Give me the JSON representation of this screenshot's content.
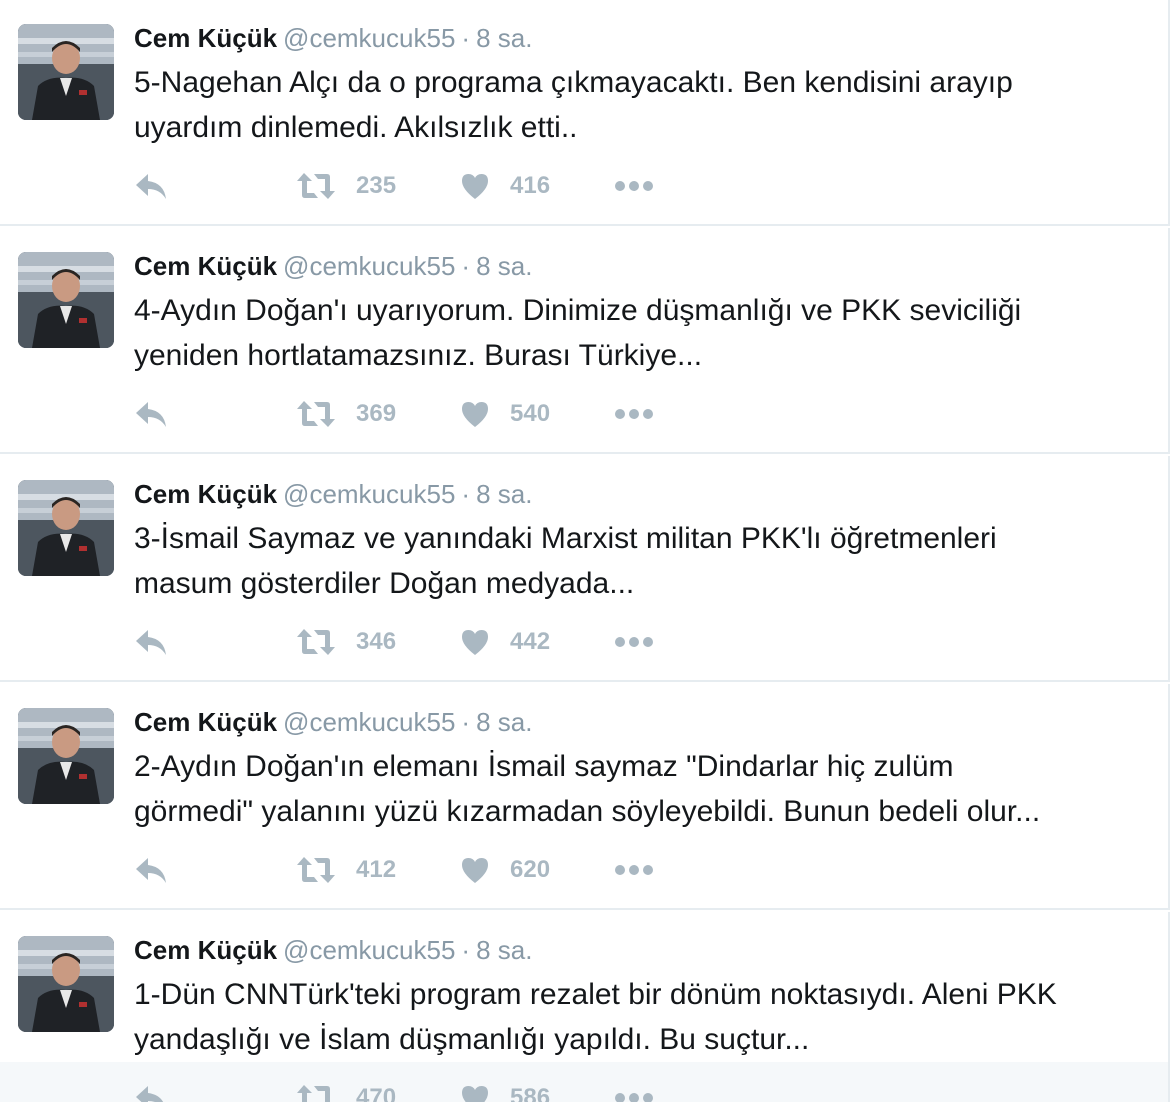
{
  "tweets": [
    {
      "name": "Cem Küçük",
      "handle": "@cemkucuk55",
      "separator": "·",
      "time": "8 sa.",
      "lines": [
        "5-Nagehan Alçı da o programa çıkmayacaktı. Ben kendisini arayıp",
        "uyardım dinlemedi. Akılsızlık etti.."
      ],
      "retweets": "235",
      "likes": "416"
    },
    {
      "name": "Cem Küçük",
      "handle": "@cemkucuk55",
      "separator": "·",
      "time": "8 sa.",
      "lines": [
        "4-Aydın Doğan'ı uyarıyorum. Dinimize düşmanlığı ve PKK seviciliği",
        "yeniden hortlatamazsınız. Burası Türkiye..."
      ],
      "retweets": "369",
      "likes": "540"
    },
    {
      "name": "Cem Küçük",
      "handle": "@cemkucuk55",
      "separator": "·",
      "time": "8 sa.",
      "lines": [
        "3-İsmail Saymaz ve yanındaki Marxist militan PKK'lı öğretmenleri",
        "masum gösterdiler Doğan medyada..."
      ],
      "retweets": "346",
      "likes": "442"
    },
    {
      "name": "Cem Küçük",
      "handle": "@cemkucuk55",
      "separator": "·",
      "time": "8 sa.",
      "lines": [
        "2-Aydın Doğan'ın elemanı İsmail saymaz \"Dindarlar hiç zulüm",
        "görmedi\" yalanını yüzü kızarmadan söyleyebildi. Bunun bedeli olur..."
      ],
      "retweets": "412",
      "likes": "620"
    },
    {
      "name": "Cem Küçük",
      "handle": "@cemkucuk55",
      "separator": "·",
      "time": "8 sa.",
      "lines": [
        "1-Dün CNNTürk'teki program rezalet bir dönüm noktasıydı. Aleni PKK",
        "yandaşlığı ve İslam düşmanlığı yapıldı. Bu suçtur..."
      ],
      "retweets": "470",
      "likes": "586"
    }
  ],
  "icons": {
    "reply": "reply-icon",
    "retweet": "retweet-icon",
    "like": "heart-icon",
    "more": "more-icon"
  },
  "colors": {
    "name": "#14171a",
    "meta": "#8899a6",
    "action": "#aab8c2",
    "divider": "#e6ecf0"
  }
}
